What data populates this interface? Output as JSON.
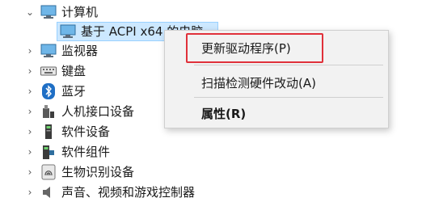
{
  "tree": {
    "computer": {
      "label": "计算机",
      "icon": "monitor-icon",
      "expanded": true
    },
    "acpi_pc": {
      "label": "基于 ACPI x64 的电脑",
      "icon": "monitor-icon"
    },
    "items": [
      {
        "label": "监视器",
        "icon": "monitor-icon"
      },
      {
        "label": "键盘",
        "icon": "keyboard-icon"
      },
      {
        "label": "蓝牙",
        "icon": "bluetooth-icon"
      },
      {
        "label": "人机接口设备",
        "icon": "hid-icon"
      },
      {
        "label": "软件设备",
        "icon": "software-device-icon"
      },
      {
        "label": "软件组件",
        "icon": "software-component-icon"
      },
      {
        "label": "生物识别设备",
        "icon": "fingerprint-icon"
      },
      {
        "label": "声音、视频和游戏控制器",
        "icon": "speaker-icon"
      }
    ]
  },
  "context_menu": {
    "update_driver": "更新驱动程序(P)",
    "scan_hardware": "扫描检测硬件改动(A)",
    "properties": "属性(R)"
  },
  "colors": {
    "selection": "#cce8ff",
    "highlight_box": "#e0313a",
    "menu_bg": "#f2f2f2"
  }
}
